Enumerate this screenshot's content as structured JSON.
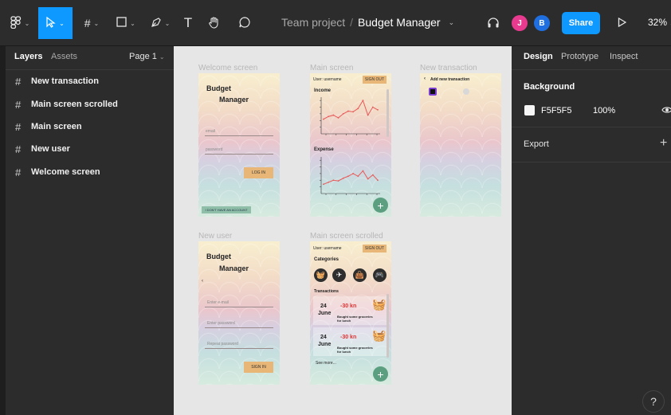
{
  "toolbar": {
    "breadcrumb_team": "Team project",
    "breadcrumb_sep": "/",
    "file_name": "Budget Manager",
    "avatars": [
      "J",
      "B"
    ],
    "share_label": "Share",
    "zoom": "32%"
  },
  "left_panel": {
    "tab_layers": "Layers",
    "tab_assets": "Assets",
    "page": "Page 1",
    "layers": [
      "New transaction",
      "Main screen scrolled",
      "Main screen",
      "New user",
      "Welcome screen"
    ]
  },
  "canvas": {
    "frame_labels": {
      "welcome": "Welcome screen",
      "main": "Main screen",
      "new_transaction": "New transaction",
      "new_user": "New user",
      "main_scrolled": "Main screen scrolled"
    },
    "welcome": {
      "title_1": "Budget",
      "title_2": "Manager",
      "email_hint": "email",
      "password_hint": "password",
      "login_button": "LOG IN",
      "no_account_button": "I DON'T HAVE AN ACCOUNT"
    },
    "main": {
      "user": "User: username",
      "sign_out": "SIGN OUT",
      "income_title": "Income",
      "expense_title": "Expense"
    },
    "new_transaction": {
      "back": "‹",
      "title": "Add new transaction"
    },
    "new_user": {
      "title_1": "Budget",
      "title_2": "Manager",
      "back": "‹",
      "email_hint": "Enter e-mail",
      "password_hint": "Enter password",
      "repeat_hint": "Repeat password",
      "sign_in_button": "SIGN IN"
    },
    "main_scrolled": {
      "user": "User: username",
      "sign_out": "SIGN OUT",
      "categories_title": "Categories",
      "transactions_title": "Transactions",
      "transactions": [
        {
          "day": "24",
          "month": "June",
          "amount": "-30 kn",
          "note": "Bought some groceries for lunch"
        },
        {
          "day": "24",
          "month": "June",
          "amount": "-30 kn",
          "note": "Bought some groceries for lunch"
        }
      ],
      "see_more": "See more..."
    }
  },
  "right_panel": {
    "tab_design": "Design",
    "tab_prototype": "Prototype",
    "tab_inspect": "Inspect",
    "background_title": "Background",
    "bg_hex": "F5F5F5",
    "bg_opacity": "100%",
    "export_title": "Export",
    "export_add": "+"
  },
  "help_label": "?",
  "colors": {
    "accent": "#0d99ff",
    "avatar_j": "#e83a8e",
    "avatar_b": "#1f6fe0",
    "chart_line": "#e85a5a",
    "amount_red": "#e03030"
  },
  "chart_data": [
    {
      "type": "line",
      "title": "Income",
      "x": [
        1,
        2,
        3,
        4,
        5,
        6,
        7,
        8,
        9,
        10,
        11,
        12
      ],
      "series": [
        {
          "values": [
            22,
            26,
            28,
            24,
            30,
            34,
            33,
            38,
            50,
            28,
            40,
            36
          ]
        }
      ],
      "xlabel": "",
      "ylabel": ""
    },
    {
      "type": "line",
      "title": "Expense",
      "x": [
        1,
        2,
        3,
        4,
        5,
        6,
        7,
        8,
        9,
        10,
        11,
        12
      ],
      "series": [
        {
          "values": [
            14,
            17,
            20,
            19,
            23,
            26,
            30,
            26,
            34,
            22,
            28,
            20
          ]
        }
      ],
      "xlabel": "",
      "ylabel": ""
    }
  ]
}
